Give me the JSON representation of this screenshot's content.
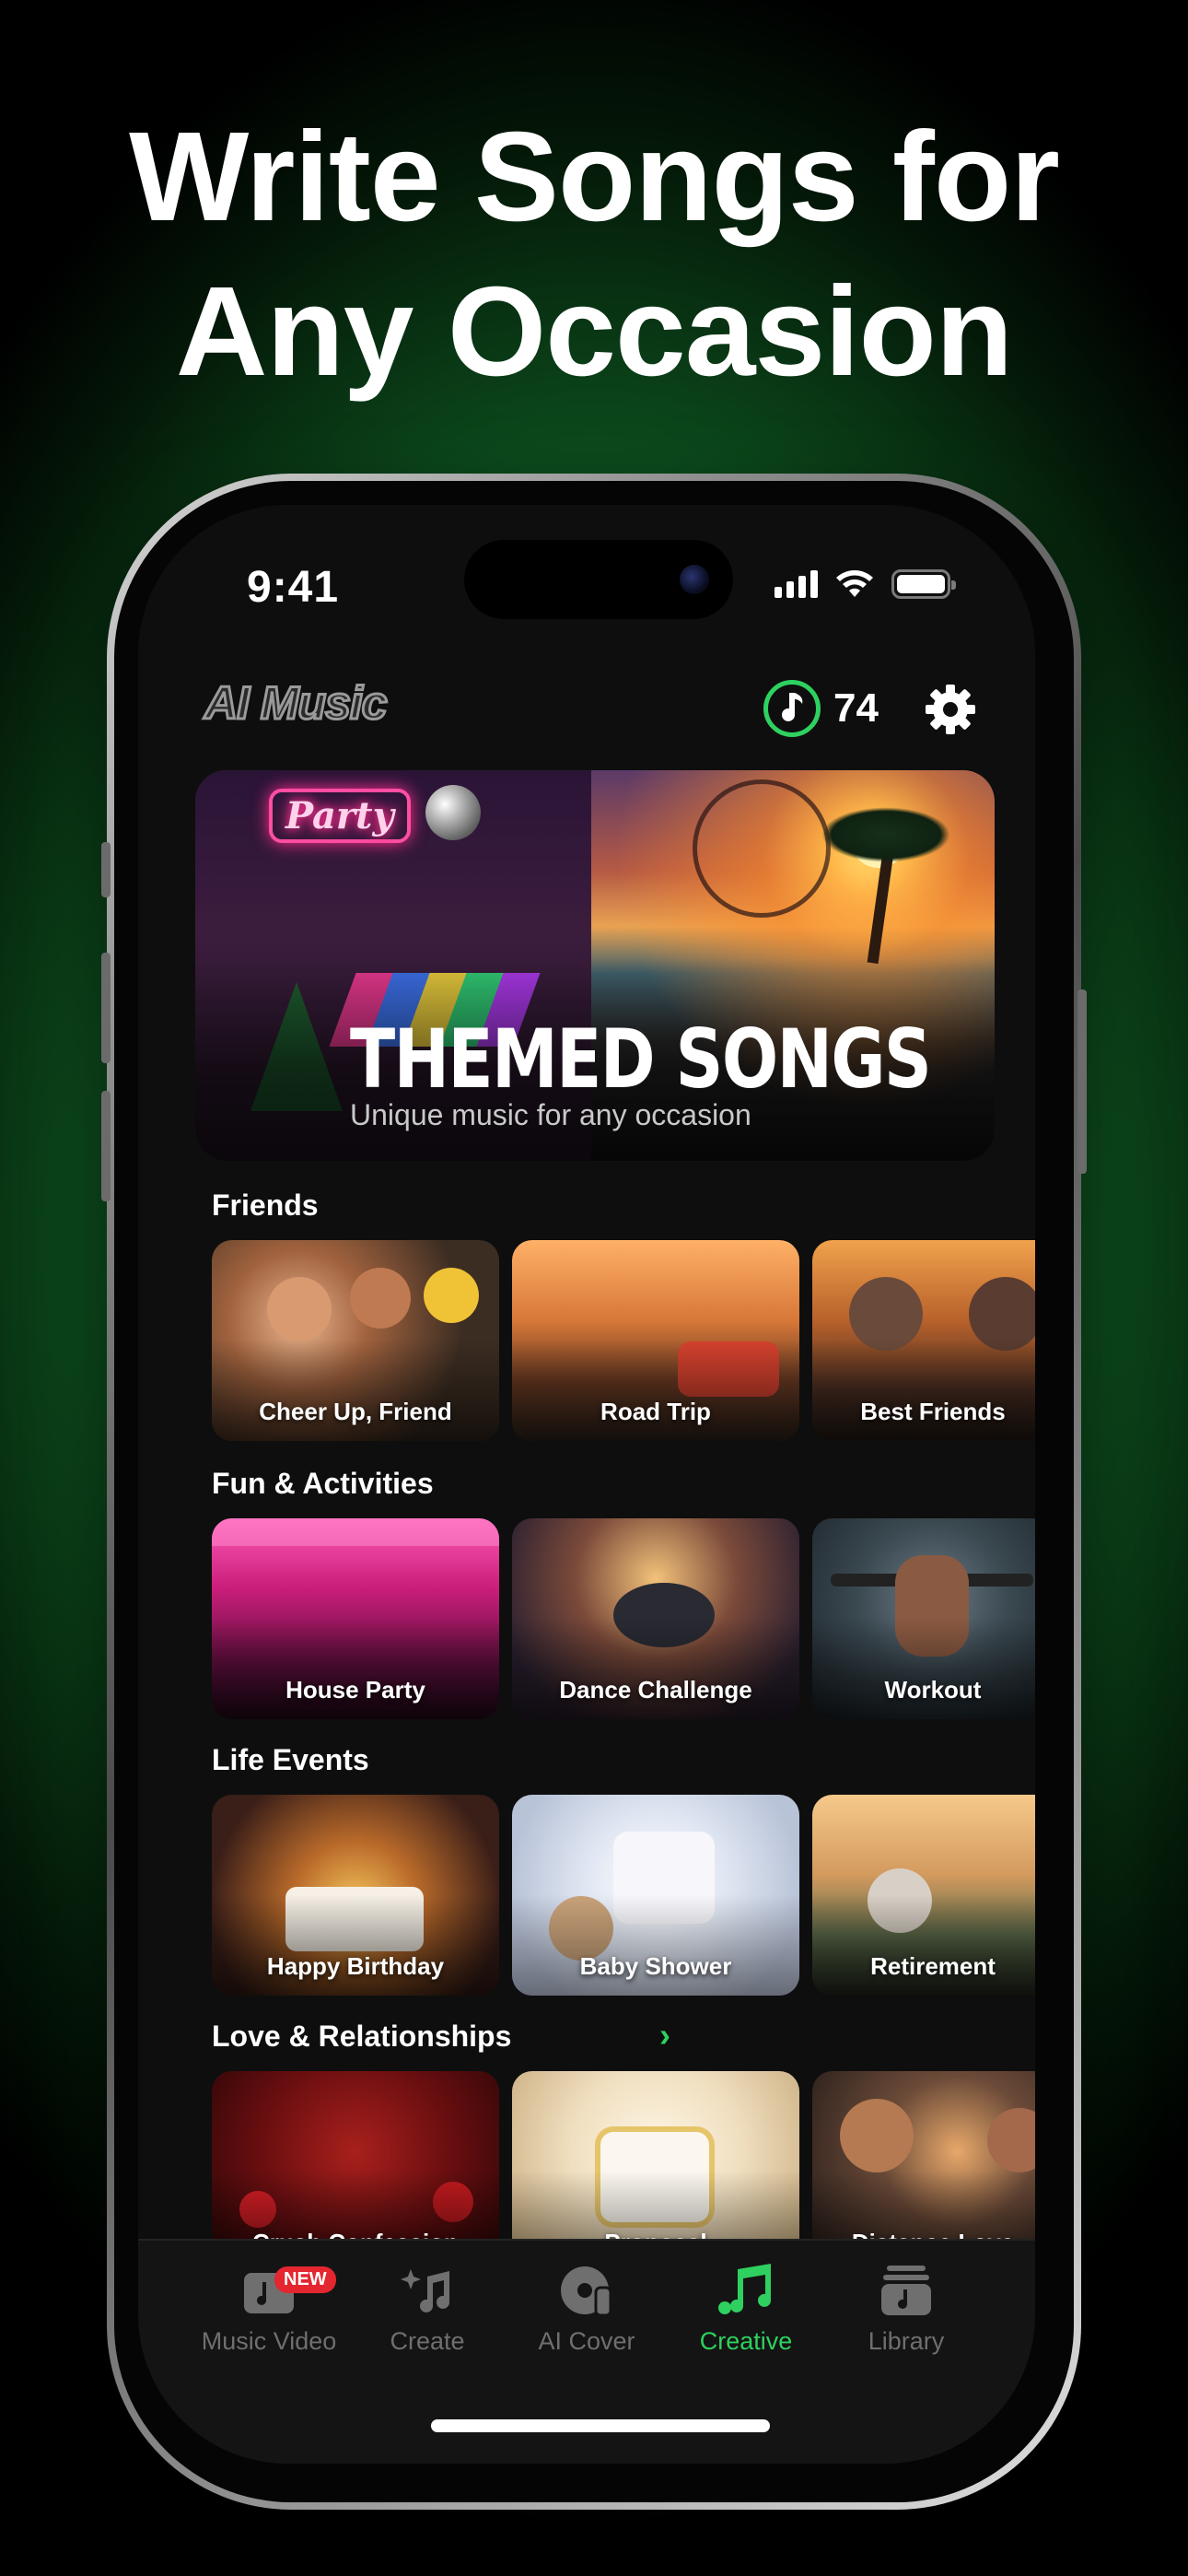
{
  "headline": {
    "line1": "Write Songs for",
    "line2": "Any Occasion"
  },
  "status_bar": {
    "time": "9:41"
  },
  "header": {
    "logo": "AI Music",
    "credits": "74"
  },
  "banner": {
    "title": "THEMED SONGS",
    "subtitle": "Unique music for any occasion",
    "sign": "Party"
  },
  "sections": [
    {
      "title": "Friends",
      "cards": [
        "Cheer Up, Friend",
        "Road Trip",
        "Best Friends"
      ]
    },
    {
      "title": "Fun & Activities",
      "cards": [
        "House Party",
        "Dance Challenge",
        "Workout"
      ]
    },
    {
      "title": "Life Events",
      "cards": [
        "Happy Birthday",
        "Baby Shower",
        "Retirement"
      ]
    },
    {
      "title": "Love & Relationships",
      "cards": [
        "Crush Confession",
        "Proposal",
        "Distance Love"
      ]
    }
  ],
  "tabbar": {
    "badge": "NEW",
    "tabs": [
      "Music Video",
      "Create",
      "AI Cover",
      "Creative",
      "Library"
    ],
    "active": "Creative"
  },
  "colors": {
    "accent": "#2ed15f",
    "background": "#0e0e0e",
    "badge": "#e3262f"
  }
}
